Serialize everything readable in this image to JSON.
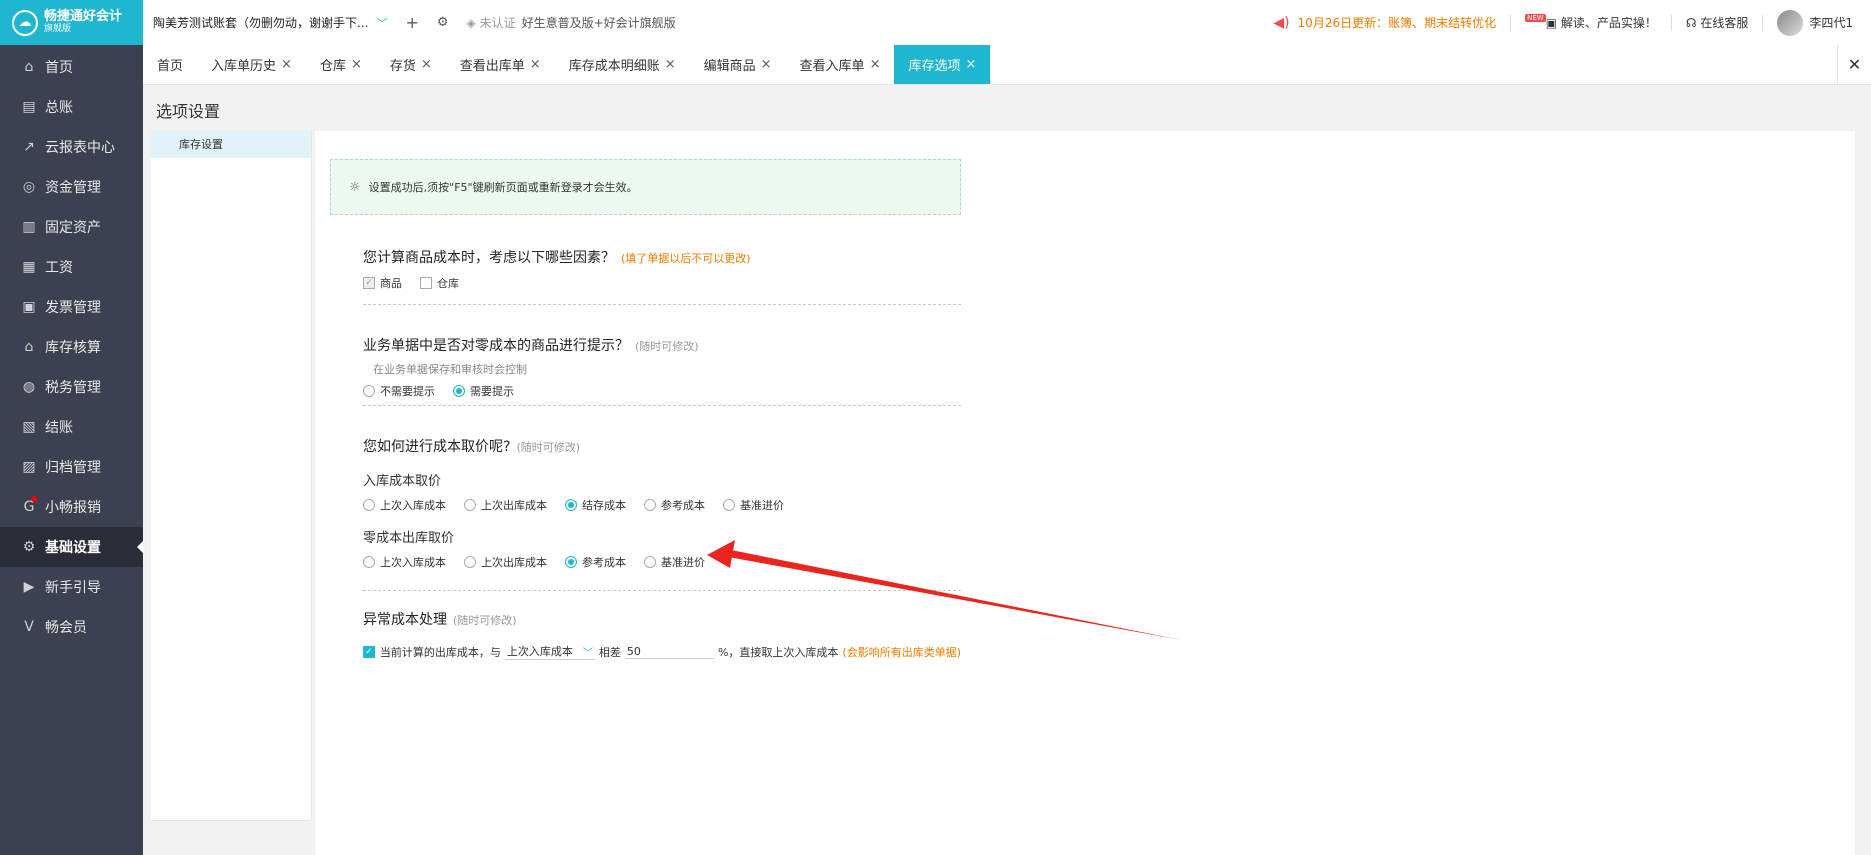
{
  "sidebar": {
    "logo_title": "畅捷通好会计",
    "logo_sub": "旗舰版",
    "items": [
      {
        "label": "首页",
        "icon": "home-icon",
        "glyph": "⌂"
      },
      {
        "label": "总账",
        "icon": "ledger-icon",
        "glyph": "▤"
      },
      {
        "label": "云报表中心",
        "icon": "chart-icon",
        "glyph": "↗"
      },
      {
        "label": "资金管理",
        "icon": "money-icon",
        "glyph": "◎"
      },
      {
        "label": "固定资产",
        "icon": "asset-icon",
        "glyph": "▥"
      },
      {
        "label": "工资",
        "icon": "salary-icon",
        "glyph": "▦"
      },
      {
        "label": "发票管理",
        "icon": "invoice-icon",
        "glyph": "▣"
      },
      {
        "label": "库存核算",
        "icon": "warehouse-icon",
        "glyph": "⌂"
      },
      {
        "label": "税务管理",
        "icon": "tax-icon",
        "glyph": "◍"
      },
      {
        "label": "结账",
        "icon": "checkout-icon",
        "glyph": "▧"
      },
      {
        "label": "归档管理",
        "icon": "archive-icon",
        "glyph": "▨"
      },
      {
        "label": "小畅报销",
        "icon": "reimburse-icon",
        "glyph": "G"
      },
      {
        "label": "基础设置",
        "icon": "gear-icon",
        "glyph": "⚙"
      },
      {
        "label": "新手引导",
        "icon": "guide-icon",
        "glyph": "▶"
      },
      {
        "label": "畅会员",
        "icon": "vip-icon",
        "glyph": "V"
      }
    ]
  },
  "topbar": {
    "account": "陶美芳测试账套（勿删勿动，谢谢手下...",
    "cert": "未认证",
    "ad": "好生意普及版+好会计旗舰版",
    "notice": "10月26日更新：账簿、期末结转优化",
    "new_badge": "NEW",
    "feature": "解读、产品实操！",
    "service": "在线客服",
    "user": "李四代1"
  },
  "tabs": [
    {
      "label": "首页",
      "closable": false
    },
    {
      "label": "入库单历史",
      "closable": true
    },
    {
      "label": "仓库",
      "closable": true
    },
    {
      "label": "存货",
      "closable": true
    },
    {
      "label": "查看出库单",
      "closable": true
    },
    {
      "label": "库存成本明细账",
      "closable": true
    },
    {
      "label": "编辑商品",
      "closable": true
    },
    {
      "label": "查看入库单",
      "closable": true
    },
    {
      "label": "库存选项",
      "closable": true
    }
  ],
  "page": {
    "title": "选项设置",
    "left_item": "库存设置",
    "tip": "设置成功后,须按\"F5\"键刷新页面或重新登录才会生效。"
  },
  "q1": {
    "title": "您计算商品成本时，考虑以下哪些因素？",
    "hint": "(填了单据以后不可以更改)",
    "opt_goods": "商品",
    "opt_warehouse": "仓库"
  },
  "q2": {
    "title": "业务单据中是否对零成本的商品进行提示？",
    "hint": "(随时可修改)",
    "sub": "在业务单据保存和审核时会控制",
    "opt_no": "不需要提示",
    "opt_yes": "需要提示"
  },
  "q3": {
    "title": "您如何进行成本取价呢?",
    "hint": "(随时可修改)",
    "in_label": "入库成本取价",
    "in_opts": [
      "上次入库成本",
      "上次出库成本",
      "结存成本",
      "参考成本",
      "基准进价"
    ],
    "in_selected": 2,
    "zero_label": "零成本出库取价",
    "zero_opts": [
      "上次入库成本",
      "上次出库成本",
      "参考成本",
      "基准进价"
    ],
    "zero_selected": 2
  },
  "q4": {
    "title": "异常成本处理",
    "hint": "(随时可修改)",
    "text1": "当前计算的出库成本，与",
    "select_value": "上次入库成本",
    "text2": "相差",
    "input_value": "50",
    "text3": "%，直接取上次入库成本",
    "hint_orange": "(会影响所有出库类单据)"
  },
  "colors": {
    "accent": "#1fb6d0",
    "sidebar": "#3d4050",
    "notice": "#f07c00",
    "arrow": "#e8261f"
  }
}
